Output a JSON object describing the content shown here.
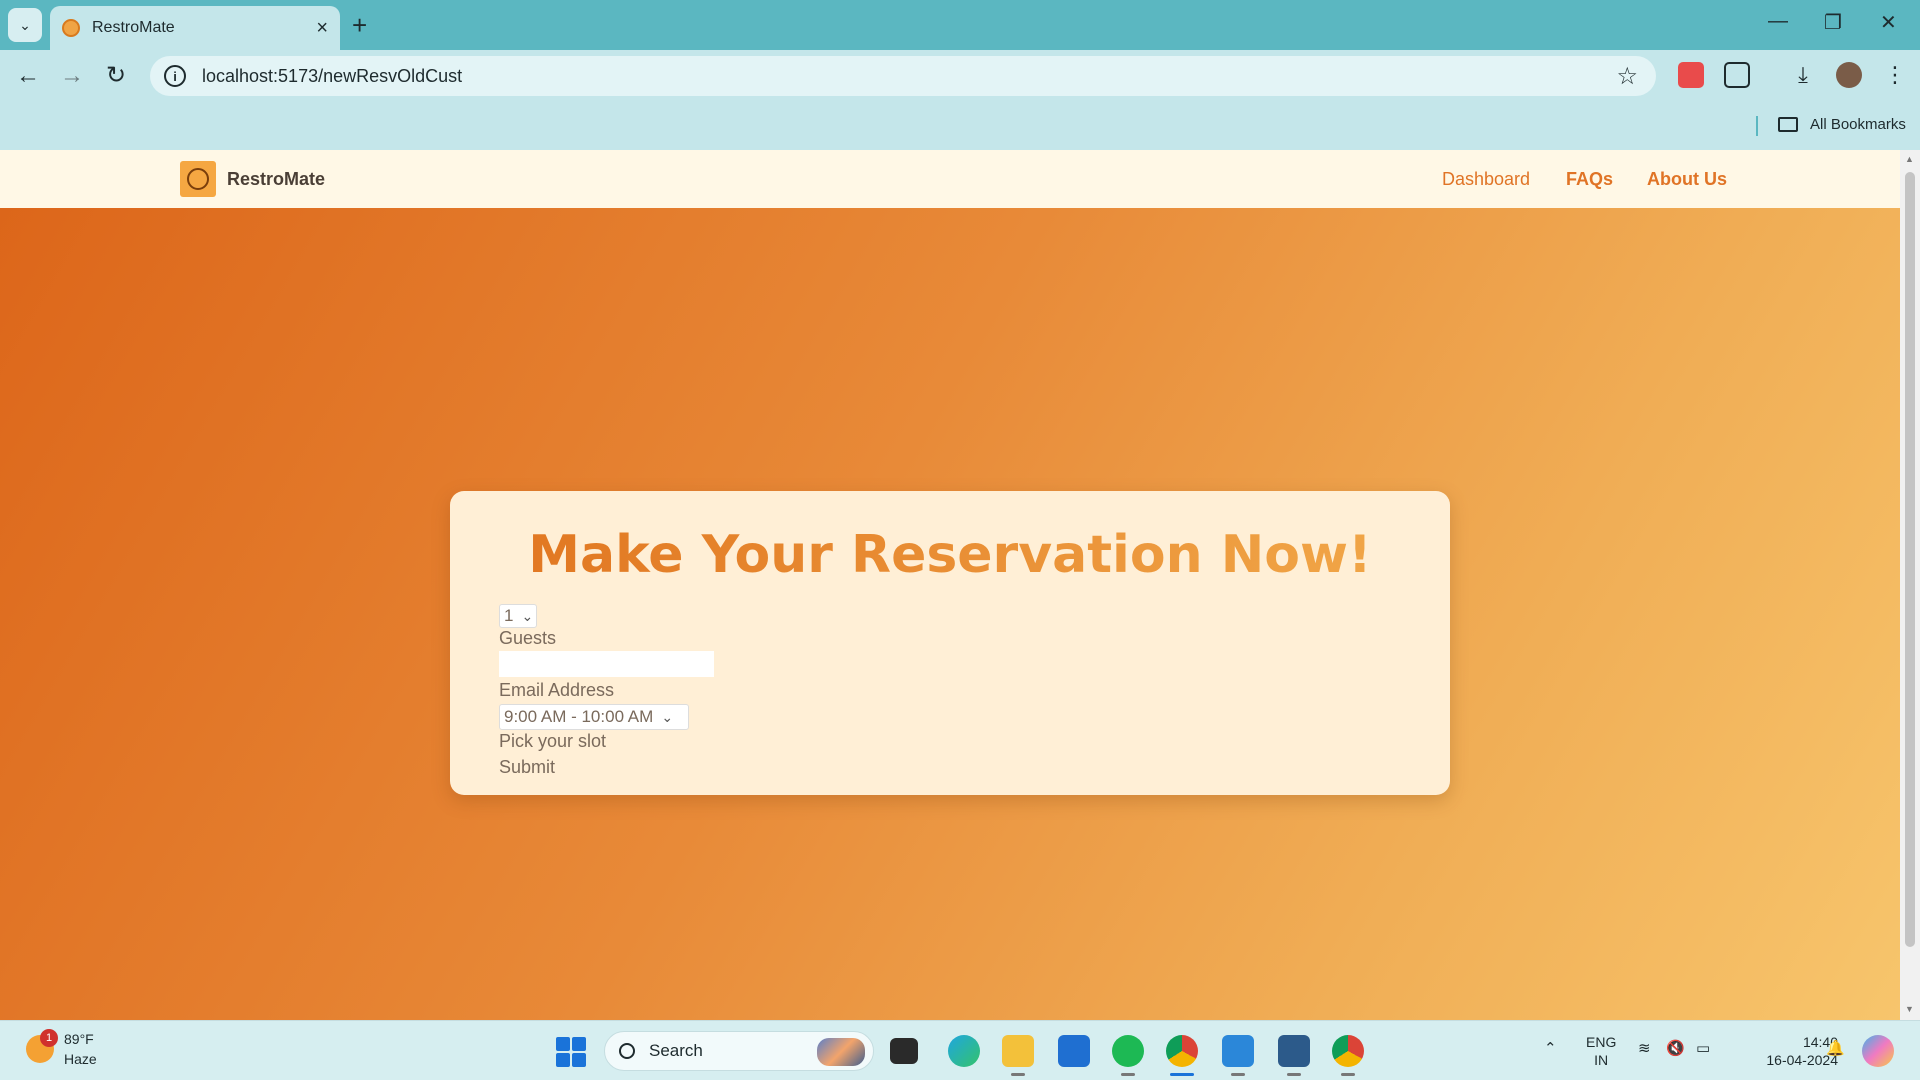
{
  "browser": {
    "tab_title": "RestroMate",
    "url": "localhost:5173/newResvOldCust",
    "bookmarks_label": "All Bookmarks"
  },
  "app": {
    "brand": "RestroMate",
    "nav": {
      "dashboard": "Dashboard",
      "faqs": "FAQs",
      "about": "About Us"
    }
  },
  "form": {
    "title": "Make Your Reservation Now!",
    "guests_value": "1",
    "guests_label": "Guests",
    "email_value": "",
    "email_label": "Email Address",
    "slot_value": "9:00 AM - 10:00 AM",
    "slot_label": "Pick your slot",
    "submit_label": "Submit"
  },
  "taskbar": {
    "weather_badge": "1",
    "temperature": "89°F",
    "condition": "Haze",
    "search_placeholder": "Search",
    "lang_line1": "ENG",
    "lang_line2": "IN",
    "time": "14:40",
    "date": "16-04-2024"
  },
  "colors": {
    "accent": "#e07426",
    "navbar_bg": "#fff8e6",
    "card_bg": "#ffefd6",
    "gradient_start": "#dc6519",
    "gradient_end": "#f7c56c"
  }
}
